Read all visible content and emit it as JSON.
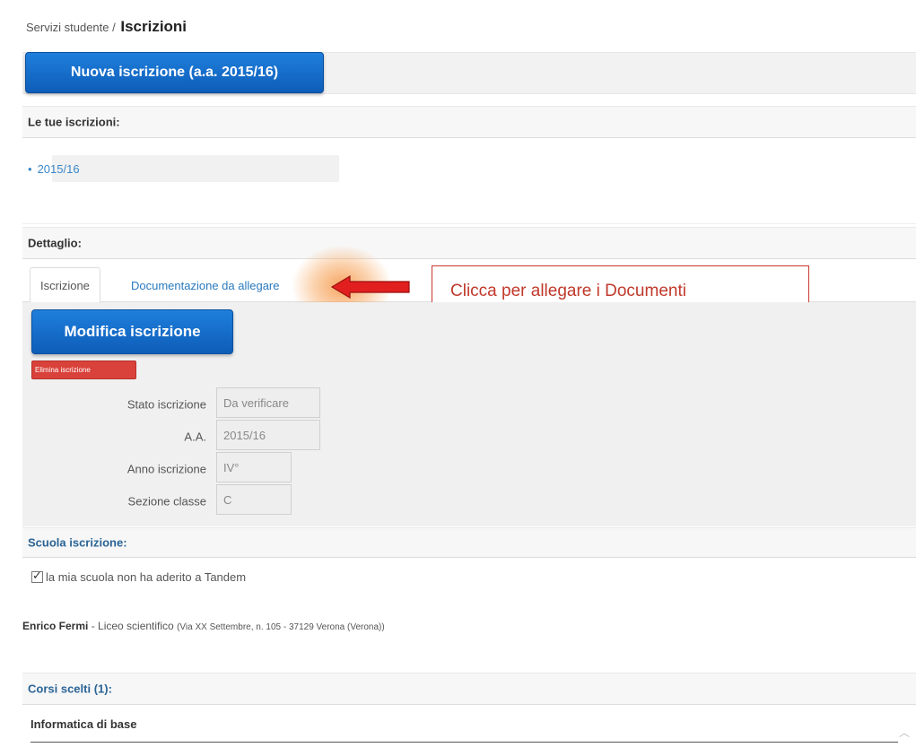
{
  "breadcrumb": {
    "parent": "Servizi studente /",
    "current": "Iscrizioni"
  },
  "new_enrollment_button": "Nuova iscrizione (a.a. 2015/16)",
  "enrollments": {
    "heading": "Le tue iscrizioni:",
    "items": [
      "2015/16"
    ]
  },
  "detail": {
    "heading": "Dettaglio:",
    "tabs": [
      "Iscrizione",
      "Documentazione da allegare"
    ],
    "edit_button": "Modifica iscrizione",
    "delete_button": "Elimina iscrizione",
    "fields": [
      {
        "label": "Stato iscrizione",
        "value": "Da verificare"
      },
      {
        "label": "A.A.",
        "value": "2015/16"
      },
      {
        "label": "Anno iscrizione",
        "value": "IV°"
      },
      {
        "label": "Sezione classe",
        "value": "C"
      }
    ]
  },
  "callout": {
    "text": "Clicca per allegare i Documenti",
    "color": "#c0392b"
  },
  "school": {
    "heading": "Scuola iscrizione:",
    "checkbox_label": "la mia scuola non ha aderito a Tandem",
    "checkbox_checked": true,
    "name": "Enrico Fermi",
    "type": " - Liceo scientifico ",
    "address": "(Via XX Settembre, n. 105 - 37129 Verona (Verona))"
  },
  "courses": {
    "heading": "Corsi scelti (1):",
    "items": [
      "Informatica di base"
    ]
  },
  "colors": {
    "primary": "#1565c0",
    "danger": "#d9423b",
    "link": "#2a7abf"
  }
}
